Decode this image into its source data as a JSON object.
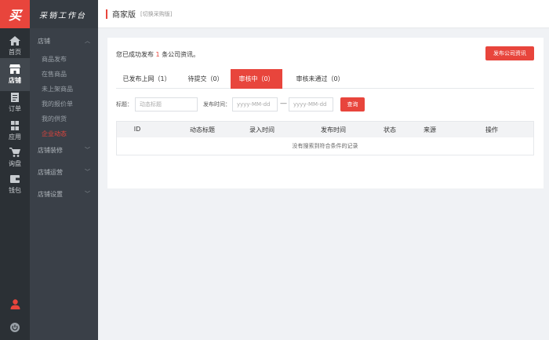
{
  "logo": {
    "text": "买"
  },
  "brand": {
    "title": "采销工作台"
  },
  "rail": [
    {
      "label": "首页",
      "icon": "home-icon"
    },
    {
      "label": "店铺",
      "icon": "store-icon",
      "active": true
    },
    {
      "label": "订单",
      "icon": "order-icon"
    },
    {
      "label": "应用",
      "icon": "apps-icon"
    },
    {
      "label": "询盘",
      "icon": "cart-icon"
    },
    {
      "label": "钱包",
      "icon": "wallet-icon"
    }
  ],
  "sidebar": {
    "groups": [
      {
        "label": "店铺",
        "expanded": true,
        "items": [
          "商品发布",
          "在售商品",
          "未上架商品",
          "我的报价单",
          "我的供货",
          "企业动态"
        ],
        "active_item": "企业动态"
      },
      {
        "label": "店铺装修",
        "expanded": false
      },
      {
        "label": "店铺运营",
        "expanded": false
      },
      {
        "label": "店铺设置",
        "expanded": false
      }
    ]
  },
  "header": {
    "title": "商家版",
    "switch_label": "[切换采购版]"
  },
  "notice": {
    "prefix": "您已成功发布",
    "count": "1",
    "suffix": "条公司资讯。"
  },
  "publish_button": "发布公司资讯",
  "tabs": [
    {
      "label": "已发布上网（1）"
    },
    {
      "label": "待提交（0）"
    },
    {
      "label": "审核中（0）",
      "active": true
    },
    {
      "label": "审核未通过（0）"
    }
  ],
  "filter": {
    "title_label": "标题：",
    "title_placeholder": "动态标题",
    "date_label": "发布时间：",
    "date_start_placeholder": "yyyy-MM-dd",
    "date_separator": "—",
    "date_end_placeholder": "yyyy-MM-dd",
    "query_button": "查询"
  },
  "table": {
    "columns": [
      "ID",
      "动态标题",
      "录入时间",
      "发布时间",
      "状态",
      "来源",
      "操作"
    ],
    "empty_text": "没有搜索到符合条件的记录"
  },
  "colors": {
    "accent": "#e8453c",
    "rail_bg": "#2b3035",
    "sidebar_bg": "#3a4048"
  }
}
